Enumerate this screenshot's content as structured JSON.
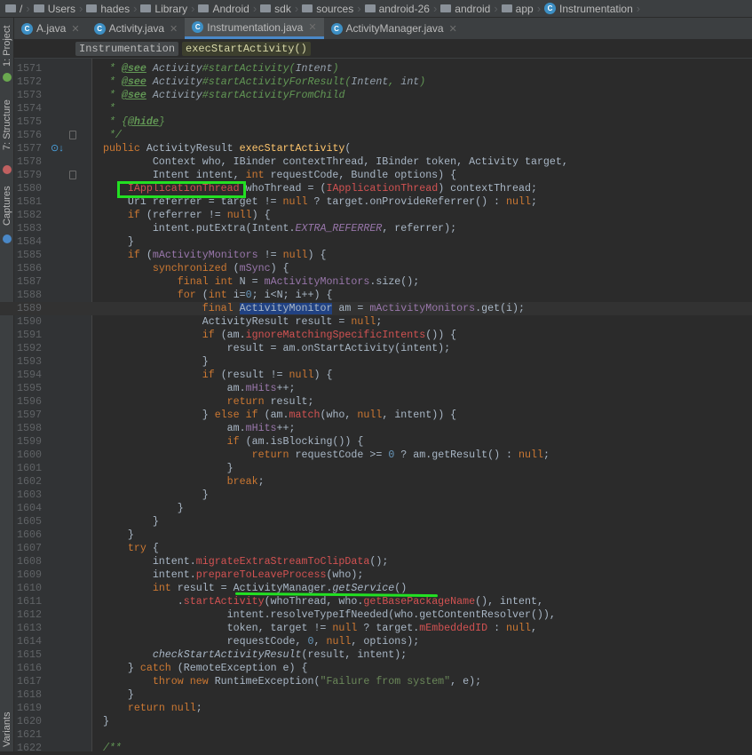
{
  "breadcrumbs": [
    "/",
    "Users",
    "hades",
    "Library",
    "Android",
    "sdk",
    "sources",
    "android-26",
    "android",
    "app",
    "Instrumentation"
  ],
  "tool_windows": [
    "1: Project",
    "7: Structure",
    "Captures",
    "Variants"
  ],
  "tabs": [
    {
      "label": "A.java",
      "active": false
    },
    {
      "label": "Activity.java",
      "active": false
    },
    {
      "label": "Instrumentation.java",
      "active": true
    },
    {
      "label": "ActivityManager.java",
      "active": false
    }
  ],
  "nav": {
    "class": "Instrumentation",
    "method": "execStartActivity()"
  },
  "colors": {
    "accent": "#4a88c7",
    "annotation": "#22e022",
    "keyword": "#cc7832",
    "field": "#9876aa",
    "error": "#d25252"
  },
  "current_line": 1589,
  "code": [
    {
      "n": "1571",
      "t": [
        [
          "",
          "     "
        ],
        [
          "cm",
          "* "
        ],
        [
          "tag",
          "@see"
        ],
        [
          "cm",
          " "
        ],
        [
          "ci",
          "Activity"
        ],
        [
          "cm",
          "#startActivity("
        ],
        [
          "ci",
          "Intent"
        ],
        [
          "cm",
          ")"
        ]
      ]
    },
    {
      "n": "1572",
      "t": [
        [
          "",
          "     "
        ],
        [
          "cm",
          "* "
        ],
        [
          "tag",
          "@see"
        ],
        [
          "cm",
          " "
        ],
        [
          "ci",
          "Activity"
        ],
        [
          "cm",
          "#startActivityForResult("
        ],
        [
          "ci",
          "Intent"
        ],
        [
          "cm",
          ", "
        ],
        [
          "ci",
          "int"
        ],
        [
          "cm",
          ")"
        ]
      ]
    },
    {
      "n": "1573",
      "t": [
        [
          "",
          "     "
        ],
        [
          "cm",
          "* "
        ],
        [
          "tag",
          "@see"
        ],
        [
          "cm",
          " "
        ],
        [
          "ci",
          "Activity"
        ],
        [
          "cm",
          "#startActivityFromChild"
        ]
      ]
    },
    {
      "n": "1574",
      "t": [
        [
          "",
          "     "
        ],
        [
          "cm",
          "*"
        ]
      ]
    },
    {
      "n": "1575",
      "t": [
        [
          "",
          "     "
        ],
        [
          "cm",
          "* {"
        ],
        [
          "tag",
          "@hide"
        ],
        [
          "cm",
          "}"
        ]
      ]
    },
    {
      "n": "1576",
      "t": [
        [
          "",
          "     "
        ],
        [
          "cm",
          "*/"
        ]
      ]
    },
    {
      "n": "1577",
      "t": [
        [
          "",
          "    "
        ],
        [
          "kw",
          "public "
        ],
        [
          "",
          "ActivityResult "
        ],
        [
          "fn",
          "execStartActivity"
        ],
        [
          "",
          "("
        ]
      ]
    },
    {
      "n": "1578",
      "t": [
        [
          "",
          "            Context who, IBinder contextThread, IBinder token, Activity target,"
        ]
      ]
    },
    {
      "n": "1579",
      "t": [
        [
          "",
          "            Intent intent, "
        ],
        [
          "kw",
          "int"
        ],
        [
          "",
          " requestCode, Bundle options) {"
        ]
      ]
    },
    {
      "n": "1580",
      "t": [
        [
          "",
          "        "
        ],
        [
          "err",
          "IApplicationThread"
        ],
        [
          "",
          " whoThread = ("
        ],
        [
          "err",
          "IApplicationThread"
        ],
        [
          "",
          ") contextThread;"
        ]
      ]
    },
    {
      "n": "1581",
      "t": [
        [
          "",
          "        Uri referrer = target != "
        ],
        [
          "kw",
          "null"
        ],
        [
          "",
          " ? target.onProvideReferrer() : "
        ],
        [
          "kw",
          "null"
        ],
        [
          "",
          ";"
        ]
      ]
    },
    {
      "n": "1582",
      "t": [
        [
          "",
          "        "
        ],
        [
          "kw",
          "if"
        ],
        [
          "",
          " (referrer != "
        ],
        [
          "kw",
          "null"
        ],
        [
          "",
          ") {"
        ]
      ]
    },
    {
      "n": "1583",
      "t": [
        [
          "",
          "            intent.putExtra(Intent."
        ],
        [
          "fldit",
          "EXTRA_REFERRER"
        ],
        [
          "",
          ", referrer);"
        ]
      ]
    },
    {
      "n": "1584",
      "t": [
        [
          "",
          "        }"
        ]
      ]
    },
    {
      "n": "1585",
      "t": [
        [
          "",
          "        "
        ],
        [
          "kw",
          "if"
        ],
        [
          "",
          " ("
        ],
        [
          "fld",
          "mActivityMonitors"
        ],
        [
          "",
          " != "
        ],
        [
          "kw",
          "null"
        ],
        [
          "",
          ") {"
        ]
      ]
    },
    {
      "n": "1586",
      "t": [
        [
          "",
          "            "
        ],
        [
          "kw",
          "synchronized"
        ],
        [
          "",
          " ("
        ],
        [
          "fld",
          "mSync"
        ],
        [
          "",
          ") {"
        ]
      ]
    },
    {
      "n": "1587",
      "t": [
        [
          "",
          "                "
        ],
        [
          "kw",
          "final int"
        ],
        [
          "",
          " N = "
        ],
        [
          "fld",
          "mActivityMonitors"
        ],
        [
          "",
          ".size();"
        ]
      ]
    },
    {
      "n": "1588",
      "t": [
        [
          "",
          "                "
        ],
        [
          "kw",
          "for"
        ],
        [
          "",
          " ("
        ],
        [
          "kw",
          "int"
        ],
        [
          "",
          " i="
        ],
        [
          "num",
          "0"
        ],
        [
          "",
          "; i<N; i++) {"
        ]
      ]
    },
    {
      "n": "1589",
      "t": [
        [
          "",
          "                    "
        ],
        [
          "kw",
          "final "
        ],
        [
          "sel",
          "ActivityMonitor"
        ],
        [
          "",
          " am = "
        ],
        [
          "fld",
          "mActivityMonitors"
        ],
        [
          "",
          ".get(i);"
        ]
      ]
    },
    {
      "n": "1590",
      "t": [
        [
          "",
          "                    ActivityResult result = "
        ],
        [
          "kw",
          "null"
        ],
        [
          "",
          ";"
        ]
      ]
    },
    {
      "n": "1591",
      "t": [
        [
          "",
          "                    "
        ],
        [
          "kw",
          "if"
        ],
        [
          "",
          " (am."
        ],
        [
          "err",
          "ignoreMatchingSpecificIntents"
        ],
        [
          "",
          "()) {"
        ]
      ]
    },
    {
      "n": "1592",
      "t": [
        [
          "",
          "                        result = am.onStartActivity(intent);"
        ]
      ]
    },
    {
      "n": "1593",
      "t": [
        [
          "",
          "                    }"
        ]
      ]
    },
    {
      "n": "1594",
      "t": [
        [
          "",
          "                    "
        ],
        [
          "kw",
          "if"
        ],
        [
          "",
          " (result != "
        ],
        [
          "kw",
          "null"
        ],
        [
          "",
          ") {"
        ]
      ]
    },
    {
      "n": "1595",
      "t": [
        [
          "",
          "                        am."
        ],
        [
          "fld",
          "mHits"
        ],
        [
          "",
          "++;"
        ]
      ]
    },
    {
      "n": "1596",
      "t": [
        [
          "",
          "                        "
        ],
        [
          "kw",
          "return"
        ],
        [
          "",
          " result;"
        ]
      ]
    },
    {
      "n": "1597",
      "t": [
        [
          "",
          "                    } "
        ],
        [
          "kw",
          "else if"
        ],
        [
          "",
          " (am."
        ],
        [
          "err",
          "match"
        ],
        [
          "",
          "(who, "
        ],
        [
          "kw",
          "null"
        ],
        [
          "",
          ", intent)) {"
        ]
      ]
    },
    {
      "n": "1598",
      "t": [
        [
          "",
          "                        am."
        ],
        [
          "fld",
          "mHits"
        ],
        [
          "",
          "++;"
        ]
      ]
    },
    {
      "n": "1599",
      "t": [
        [
          "",
          "                        "
        ],
        [
          "kw",
          "if"
        ],
        [
          "",
          " (am.isBlocking()) {"
        ]
      ]
    },
    {
      "n": "1600",
      "t": [
        [
          "",
          "                            "
        ],
        [
          "kw",
          "return"
        ],
        [
          "",
          " requestCode >= "
        ],
        [
          "num",
          "0"
        ],
        [
          "",
          " ? am.getResult() : "
        ],
        [
          "kw",
          "null"
        ],
        [
          "",
          ";"
        ]
      ]
    },
    {
      "n": "1601",
      "t": [
        [
          "",
          "                        }"
        ]
      ]
    },
    {
      "n": "1602",
      "t": [
        [
          "",
          "                        "
        ],
        [
          "kw",
          "break"
        ],
        [
          "",
          ";"
        ]
      ]
    },
    {
      "n": "1603",
      "t": [
        [
          "",
          "                    }"
        ]
      ]
    },
    {
      "n": "1604",
      "t": [
        [
          "",
          "                }"
        ]
      ]
    },
    {
      "n": "1605",
      "t": [
        [
          "",
          "            }"
        ]
      ]
    },
    {
      "n": "1606",
      "t": [
        [
          "",
          "        }"
        ]
      ]
    },
    {
      "n": "1607",
      "t": [
        [
          "",
          "        "
        ],
        [
          "kw",
          "try"
        ],
        [
          "",
          " {"
        ]
      ]
    },
    {
      "n": "1608",
      "t": [
        [
          "",
          "            intent."
        ],
        [
          "err",
          "migrateExtraStreamToClipData"
        ],
        [
          "",
          "();"
        ]
      ]
    },
    {
      "n": "1609",
      "t": [
        [
          "",
          "            intent."
        ],
        [
          "err",
          "prepareToLeaveProcess"
        ],
        [
          "",
          "(who);"
        ]
      ]
    },
    {
      "n": "1610",
      "t": [
        [
          "",
          "            "
        ],
        [
          "kw",
          "int"
        ],
        [
          "",
          " result = ActivityManager."
        ],
        [
          "it",
          "getService"
        ],
        [
          "",
          "()"
        ]
      ]
    },
    {
      "n": "1611",
      "t": [
        [
          "",
          "                ."
        ],
        [
          "err",
          "startActivity"
        ],
        [
          "",
          "(whoThread, who."
        ],
        [
          "err",
          "getBasePackageName"
        ],
        [
          "",
          "(), intent,"
        ]
      ]
    },
    {
      "n": "1612",
      "t": [
        [
          "",
          "                        intent.resolveTypeIfNeeded(who.getContentResolver()),"
        ]
      ]
    },
    {
      "n": "1613",
      "t": [
        [
          "",
          "                        token, target != "
        ],
        [
          "kw",
          "null"
        ],
        [
          "",
          " ? target."
        ],
        [
          "err",
          "mEmbeddedID"
        ],
        [
          "",
          " : "
        ],
        [
          "kw",
          "null"
        ],
        [
          "",
          ","
        ]
      ]
    },
    {
      "n": "1614",
      "t": [
        [
          "",
          "                        requestCode, "
        ],
        [
          "num",
          "0"
        ],
        [
          "",
          ", "
        ],
        [
          "kw",
          "null"
        ],
        [
          "",
          ", options);"
        ]
      ]
    },
    {
      "n": "1615",
      "t": [
        [
          "",
          "            "
        ],
        [
          "it",
          "checkStartActivityResult"
        ],
        [
          "",
          "(result, intent);"
        ]
      ]
    },
    {
      "n": "1616",
      "t": [
        [
          "",
          "        } "
        ],
        [
          "kw",
          "catch"
        ],
        [
          "",
          " (RemoteException e) {"
        ]
      ]
    },
    {
      "n": "1617",
      "t": [
        [
          "",
          "            "
        ],
        [
          "kw",
          "throw new"
        ],
        [
          "",
          " RuntimeException("
        ],
        [
          "str",
          "\"Failure from system\""
        ],
        [
          "",
          ", e);"
        ]
      ]
    },
    {
      "n": "1618",
      "t": [
        [
          "",
          "        }"
        ]
      ]
    },
    {
      "n": "1619",
      "t": [
        [
          "",
          "        "
        ],
        [
          "kw",
          "return null"
        ],
        [
          "",
          ";"
        ]
      ]
    },
    {
      "n": "1620",
      "t": [
        [
          "",
          "    }"
        ]
      ]
    },
    {
      "n": "1621",
      "t": []
    },
    {
      "n": "1622",
      "t": [
        [
          "",
          "    "
        ],
        [
          "cm",
          "/**"
        ]
      ]
    }
  ]
}
